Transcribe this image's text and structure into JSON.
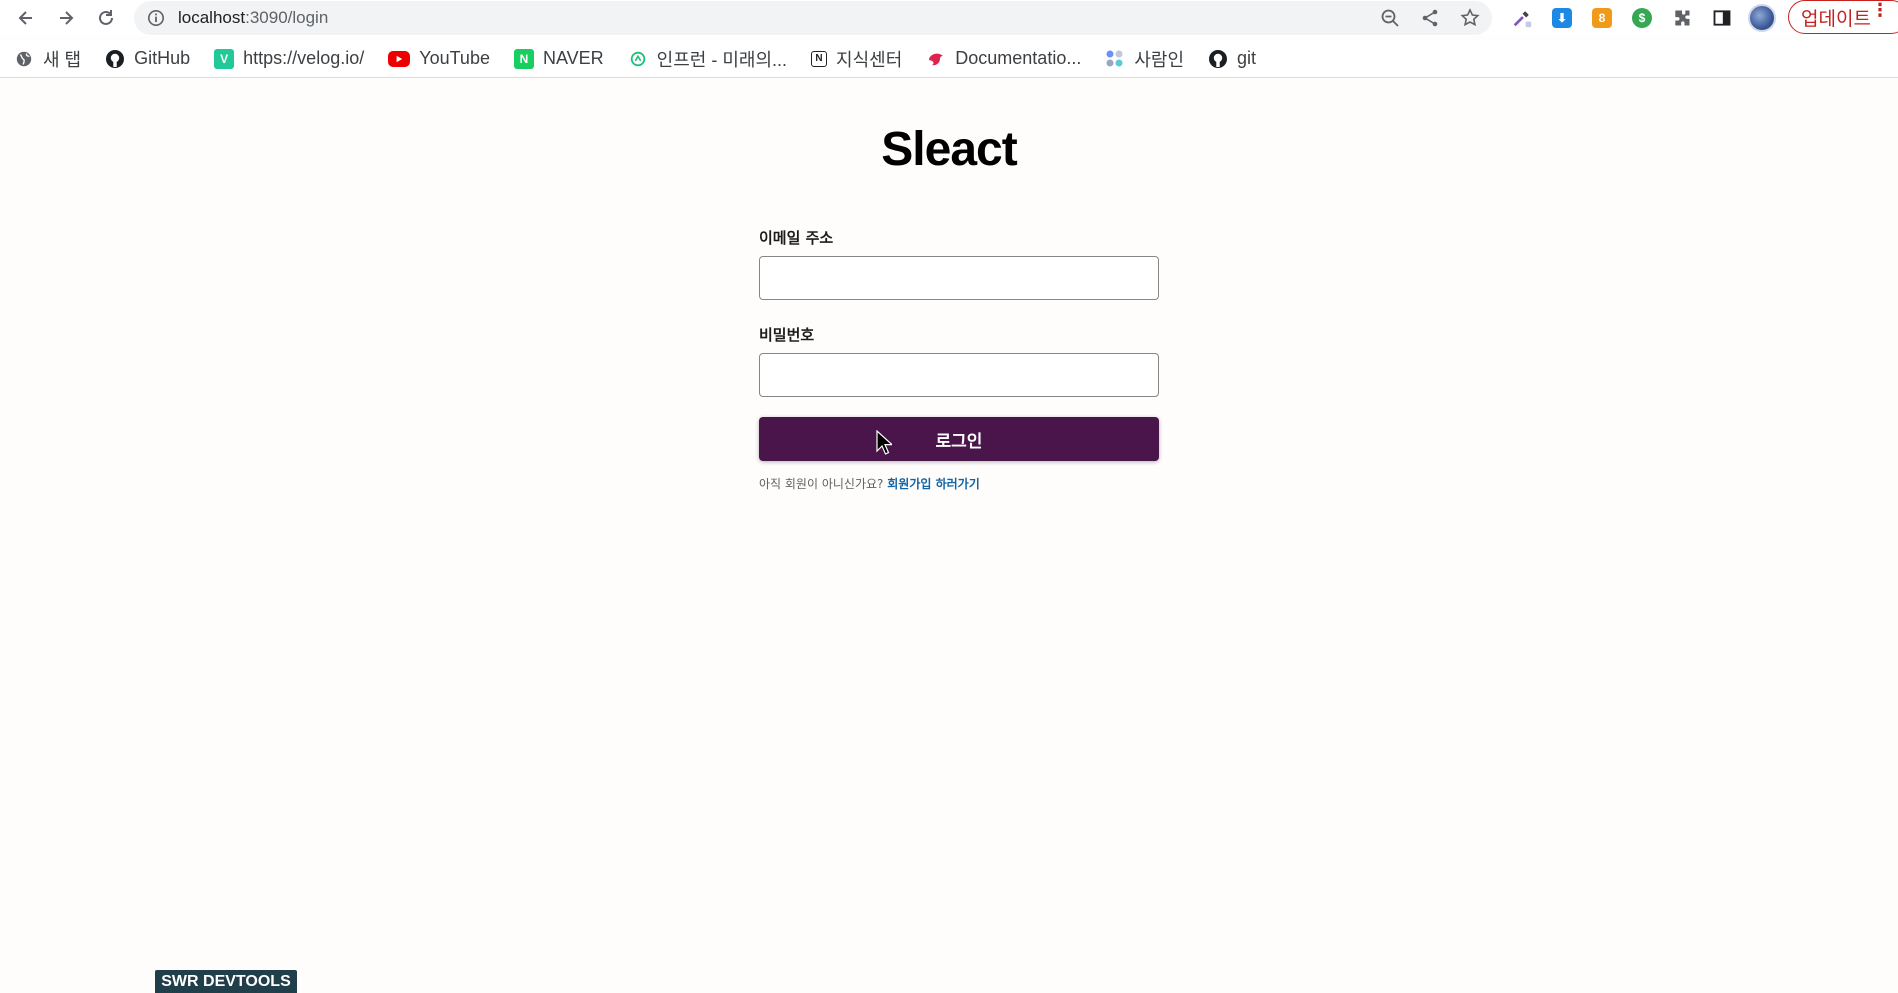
{
  "browser": {
    "url_host": "localhost",
    "url_rest": ":3090/login",
    "update_label": "업데이트",
    "extension_badge_number": "8",
    "bookmarks": [
      {
        "label": "새 탭",
        "icon": "globe-icon"
      },
      {
        "label": "GitHub",
        "icon": "github-icon"
      },
      {
        "label": "https://velog.io/",
        "icon": "velog-icon"
      },
      {
        "label": "YouTube",
        "icon": "youtube-icon"
      },
      {
        "label": "NAVER",
        "icon": "naver-icon"
      },
      {
        "label": "인프런 - 미래의...",
        "icon": "inflearn-icon"
      },
      {
        "label": "지식센터",
        "icon": "notion-icon"
      },
      {
        "label": "Documentatio...",
        "icon": "nestjs-icon"
      },
      {
        "label": "사람인",
        "icon": "saramin-icon"
      },
      {
        "label": "git",
        "icon": "github-icon"
      }
    ]
  },
  "page": {
    "brand": "Sleact",
    "email_label": "이메일 주소",
    "email_value": "",
    "password_label": "비밀번호",
    "password_value": "",
    "login_button": "로그인",
    "signup_prompt": "아직 회원이 아니신가요?",
    "signup_link": "회원가입 하러가기",
    "devtools_label": "SWR DEVTOOLS"
  },
  "colors": {
    "primary": "#4a154b",
    "link": "#1264a3",
    "page_bg": "#fefdfc",
    "devtools_bg": "#203f4a",
    "update_red": "#c5221f"
  }
}
